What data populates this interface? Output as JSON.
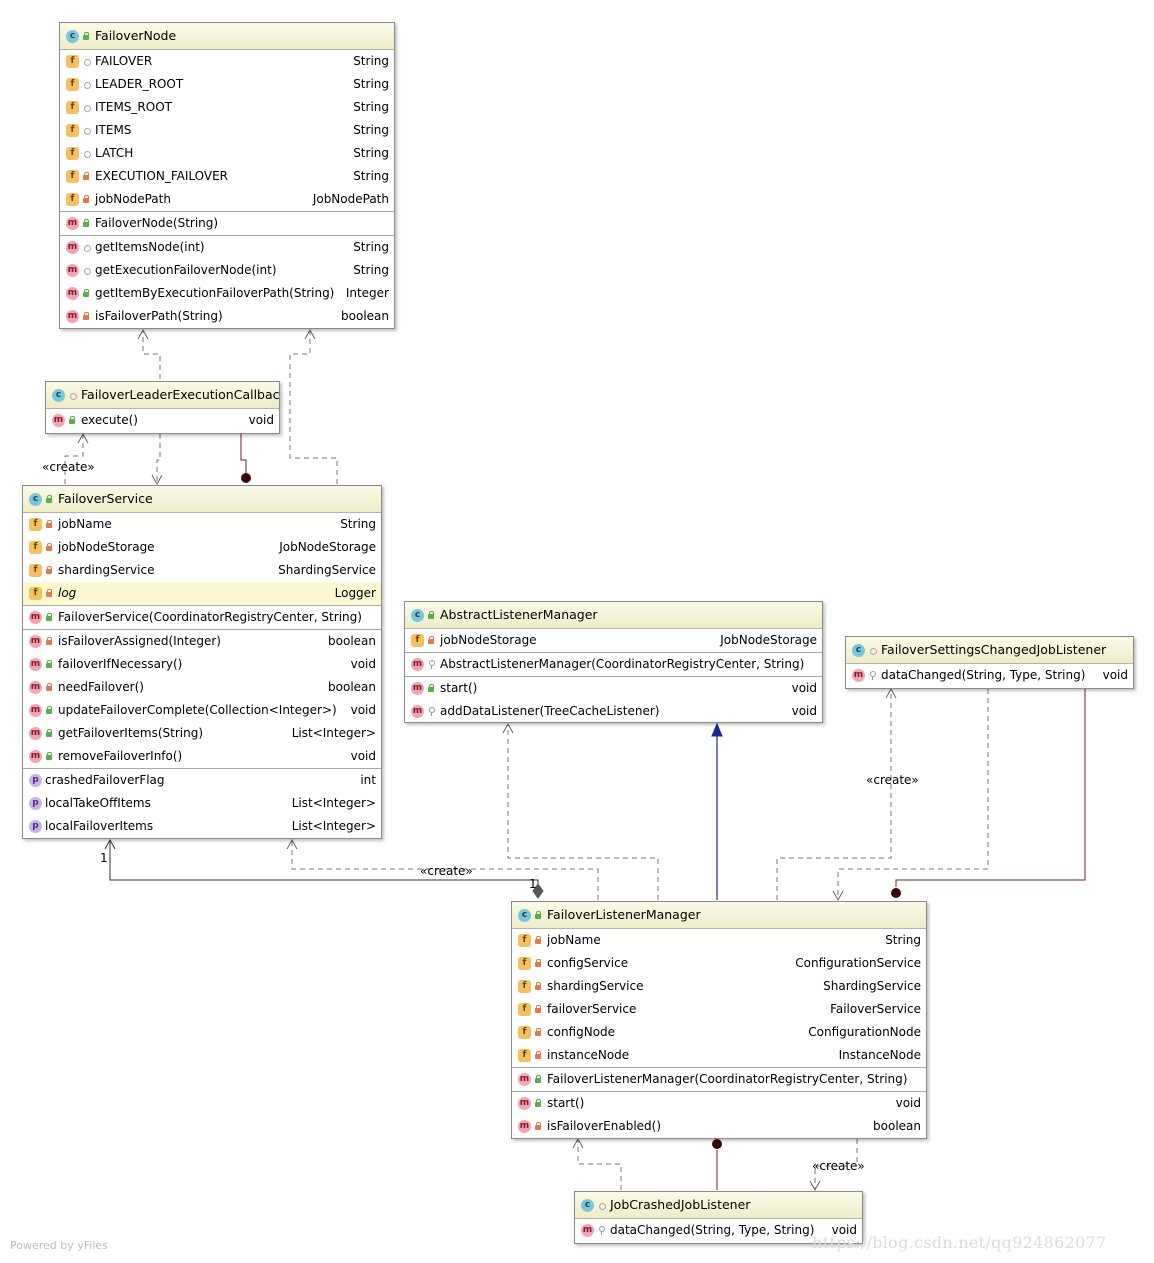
{
  "failover_node": {
    "name": "FailoverNode",
    "fields": [
      {
        "name": "FAILOVER",
        "type": "String"
      },
      {
        "name": "LEADER_ROOT",
        "type": "String"
      },
      {
        "name": "ITEMS_ROOT",
        "type": "String"
      },
      {
        "name": "ITEMS",
        "type": "String"
      },
      {
        "name": "LATCH",
        "type": "String"
      },
      {
        "name": "EXECUTION_FAILOVER",
        "type": "String"
      },
      {
        "name": "jobNodePath",
        "type": "JobNodePath"
      }
    ],
    "constructors": [
      {
        "name": "FailoverNode(String)",
        "type": ""
      }
    ],
    "methods": [
      {
        "name": "getItemsNode(int)",
        "type": "String"
      },
      {
        "name": "getExecutionFailoverNode(int)",
        "type": "String"
      },
      {
        "name": "getItemByExecutionFailoverPath(String)",
        "type": "Integer"
      },
      {
        "name": "isFailoverPath(String)",
        "type": "boolean"
      }
    ]
  },
  "callback": {
    "name": "FailoverLeaderExecutionCallback",
    "methods": [
      {
        "name": "execute()",
        "type": "void"
      }
    ]
  },
  "failover_service": {
    "name": "FailoverService",
    "fields": [
      {
        "name": "jobName",
        "type": "String"
      },
      {
        "name": "jobNodeStorage",
        "type": "JobNodeStorage"
      },
      {
        "name": "shardingService",
        "type": "ShardingService"
      },
      {
        "name": "log",
        "type": "Logger"
      }
    ],
    "constructors": [
      {
        "name": "FailoverService(CoordinatorRegistryCenter, String)",
        "type": ""
      }
    ],
    "methods": [
      {
        "name": "isFailoverAssigned(Integer)",
        "type": "boolean"
      },
      {
        "name": "failoverIfNecessary()",
        "type": "void"
      },
      {
        "name": "needFailover()",
        "type": "boolean"
      },
      {
        "name": "updateFailoverComplete(Collection<Integer>)",
        "type": "void"
      },
      {
        "name": "getFailoverItems(String)",
        "type": "List<Integer>"
      },
      {
        "name": "removeFailoverInfo()",
        "type": "void"
      }
    ],
    "properties": [
      {
        "name": "crashedFailoverFlag",
        "type": "int"
      },
      {
        "name": "localTakeOffItems",
        "type": "List<Integer>"
      },
      {
        "name": "localFailoverItems",
        "type": "List<Integer>"
      }
    ]
  },
  "abstract_listener": {
    "name": "AbstractListenerManager",
    "fields": [
      {
        "name": "jobNodeStorage",
        "type": "JobNodeStorage"
      }
    ],
    "constructors": [
      {
        "name": "AbstractListenerManager(CoordinatorRegistryCenter, String)",
        "type": ""
      }
    ],
    "methods": [
      {
        "name": "start()",
        "type": "void"
      },
      {
        "name": "addDataListener(TreeCacheListener)",
        "type": "void"
      }
    ]
  },
  "settings_listener": {
    "name": "FailoverSettingsChangedJobListener",
    "methods": [
      {
        "name": "dataChanged(String, Type, String)",
        "type": "void"
      }
    ]
  },
  "listener_manager": {
    "name": "FailoverListenerManager",
    "fields": [
      {
        "name": "jobName",
        "type": "String"
      },
      {
        "name": "configService",
        "type": "ConfigurationService"
      },
      {
        "name": "shardingService",
        "type": "ShardingService"
      },
      {
        "name": "failoverService",
        "type": "FailoverService"
      },
      {
        "name": "configNode",
        "type": "ConfigurationNode"
      },
      {
        "name": "instanceNode",
        "type": "InstanceNode"
      }
    ],
    "constructors": [
      {
        "name": "FailoverListenerManager(CoordinatorRegistryCenter, String)",
        "type": ""
      }
    ],
    "methods": [
      {
        "name": "start()",
        "type": "void"
      },
      {
        "name": "isFailoverEnabled()",
        "type": "boolean"
      }
    ]
  },
  "crashed_listener": {
    "name": "JobCrashedJobListener",
    "methods": [
      {
        "name": "dataChanged(String, Type, String)",
        "type": "void"
      }
    ]
  },
  "labels": {
    "create_1": "«create»",
    "create_2": "«create»",
    "create_3": "«create»",
    "create_4": "«create»",
    "mult_one_left": "1",
    "mult_one_right": "1",
    "footer": "Powered by yFiles",
    "watermark": "https://blog.csdn.net/qq924862077"
  }
}
